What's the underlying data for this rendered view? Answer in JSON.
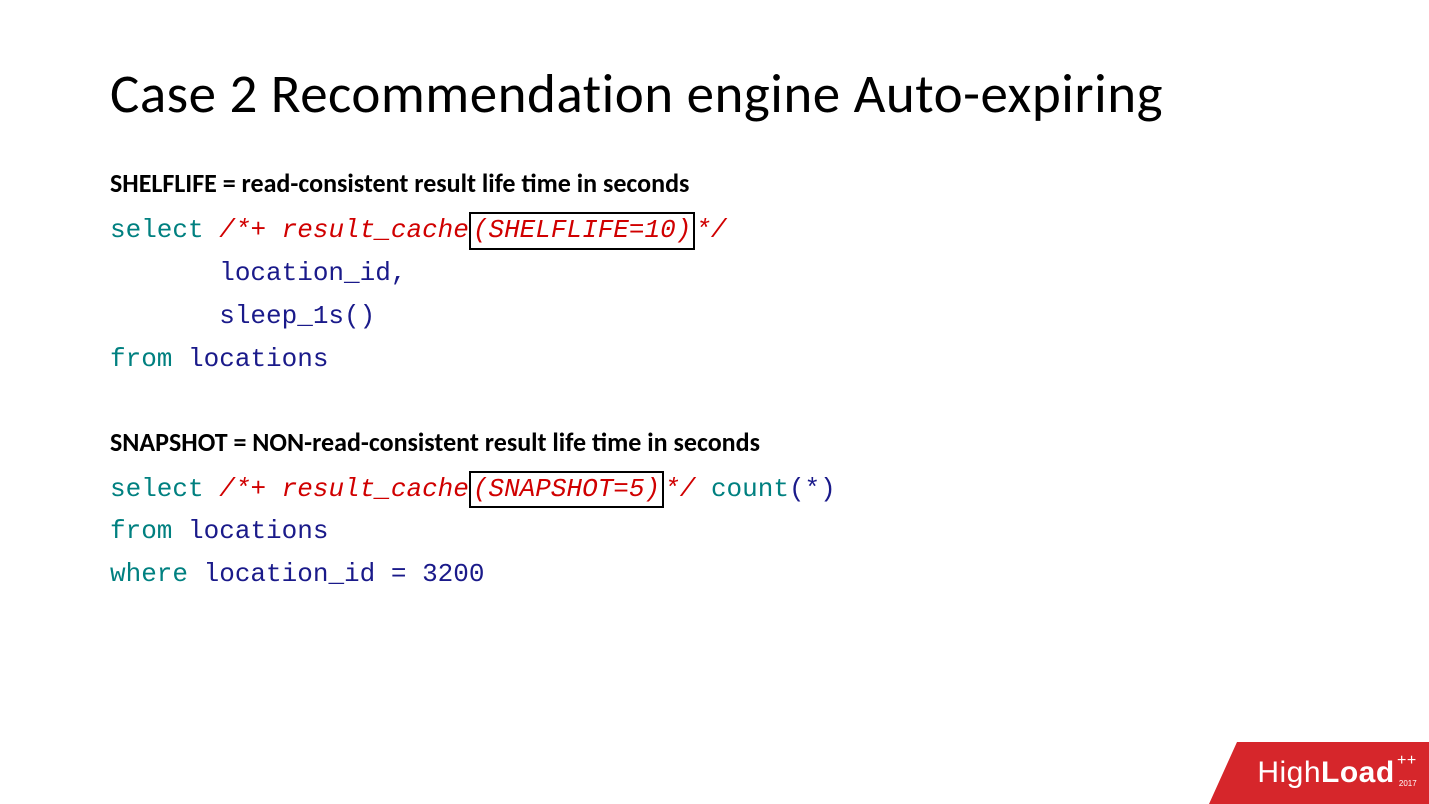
{
  "title": "Case 2 Recommendation engine Auto-expiring",
  "section1": {
    "heading": "SHELFLIFE = read-consistent result life time in seconds",
    "code": {
      "kw_select": "select",
      "hint_open": "/*+ result_cache",
      "hint_boxed": "(SHELFLIFE=10)",
      "hint_close": "*/",
      "col1": "location_id,",
      "col2": "sleep_1s()",
      "kw_from": "from",
      "tbl": "locations"
    }
  },
  "section2": {
    "heading": "SNAPSHOT = NON-read-consistent result life time in seconds",
    "code": {
      "kw_select": "select",
      "hint_open": "/*+ result_cache",
      "hint_boxed": "(SNAPSHOT=5)",
      "hint_close": "*/",
      "count_kw": "count",
      "count_arg": "(*)",
      "kw_from": "from",
      "tbl": "locations",
      "kw_where": "where",
      "where_col": "location_id",
      "where_eq": " = ",
      "where_val": "3200"
    }
  },
  "logo": {
    "part1": "High",
    "part2": "Load",
    "pp": "++",
    "year": "2017"
  }
}
